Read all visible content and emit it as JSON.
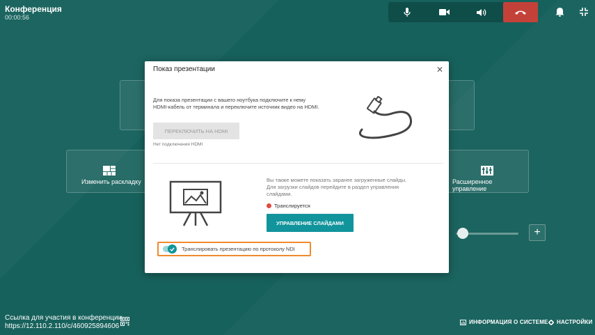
{
  "header": {
    "title": "Конференция",
    "timer": "00:00:56"
  },
  "callbar": {
    "buttons": [
      {
        "name": "microphone",
        "icon": "microphone-icon"
      },
      {
        "name": "camera",
        "icon": "camera-icon"
      },
      {
        "name": "speaker",
        "icon": "speaker-icon"
      },
      {
        "name": "hangup",
        "icon": "phone-hangup-icon"
      }
    ],
    "hangup_color": "#c4413a"
  },
  "top_right": {
    "icons": [
      "bell-icon",
      "collapse-fullscreen-icon"
    ]
  },
  "background_tiles": {
    "change_layout": "Изменить раскладку",
    "advanced_control": "Расширенное управление"
  },
  "modal": {
    "title": "Показ презентации",
    "hdmi_description": "Для показа презентации с вашего ноутбука подключите к нему HDMI-кабель от терминала и переключите источник видео на HDMI.",
    "hdmi_button": "ПЕРЕКЛЮЧИТЬ НА HDMI",
    "hdmi_status": "Нет подключения HDMI",
    "slides_description": "Вы также можете показать заранее загруженные слайды. Для загрузки слайдов перейдите в раздел управления слайдами.",
    "live_status": "Транслируется",
    "slides_button": "УПРАВЛЕНИЕ СЛАЙДАМИ",
    "ndi_label": "Транслировать презентацию по протоколу NDI",
    "ndi_enabled": true,
    "accent_color": "#11949c",
    "highlight_color": "#f08a2c"
  },
  "footer": {
    "link_title": "Ссылка для участия в конференции",
    "link_url": "https://12.110.2.110/c/460925894606",
    "system_info": "ИНФОРМАЦИЯ О СИСТЕМЕ",
    "settings": "НАСТРОЙКИ"
  },
  "colors": {
    "background": "#17615c"
  }
}
